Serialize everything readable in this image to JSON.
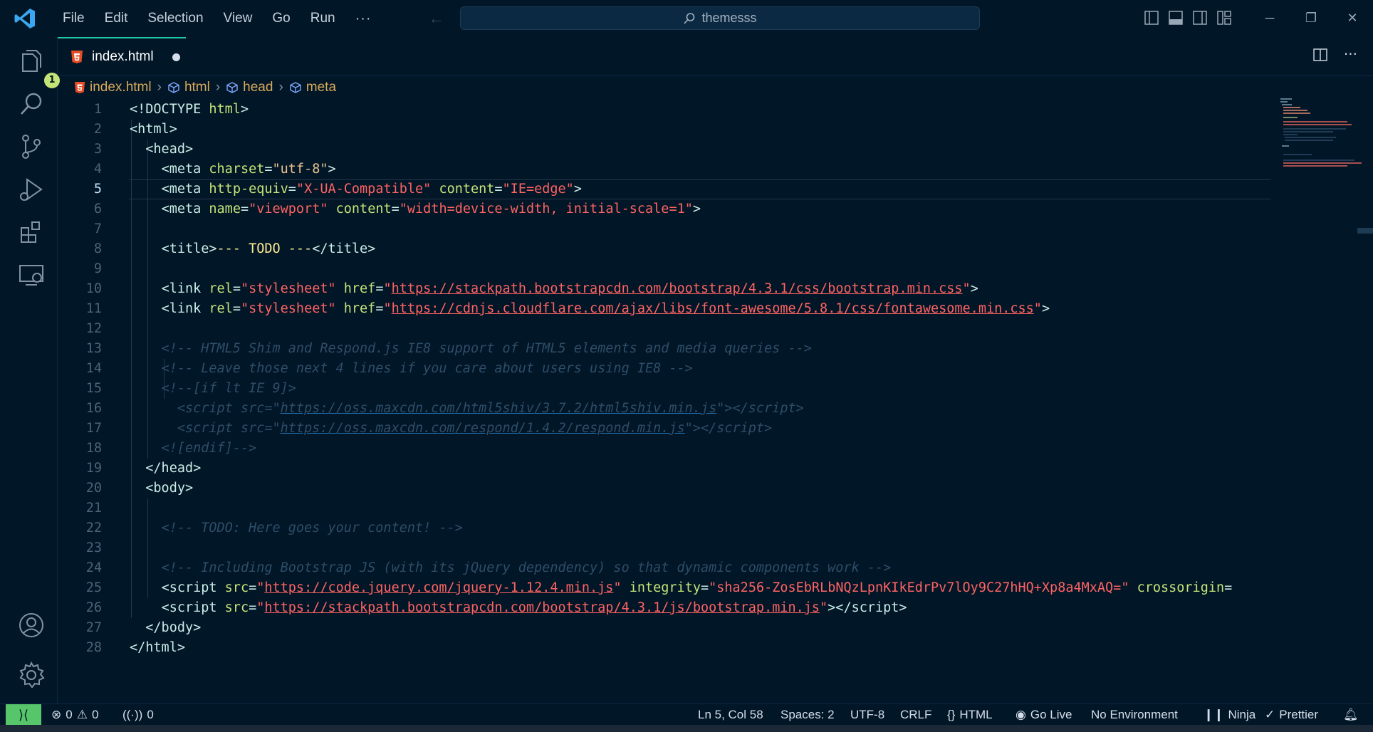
{
  "titlebar": {
    "menu": [
      "File",
      "Edit",
      "Selection",
      "View",
      "Go",
      "Run"
    ],
    "more": "···",
    "search_text": "themesss",
    "icons": [
      "toggle-primary-sidebar-icon",
      "toggle-panel-icon",
      "toggle-secondary-sidebar-icon",
      "customize-layout-icon"
    ],
    "window_controls": [
      "─",
      "❐",
      "✕"
    ]
  },
  "activitybar": {
    "items": [
      "explorer-icon",
      "search-icon",
      "source-control-icon",
      "run-debug-icon",
      "extensions-icon",
      "remote-explorer-icon"
    ],
    "explorer_badge": "1",
    "bottom": [
      "accounts-icon",
      "manage-gear-icon"
    ]
  },
  "tab": {
    "filename": "index.html",
    "modified": true
  },
  "breadcrumb": {
    "file": "index.html",
    "items": [
      "html",
      "head",
      "meta"
    ]
  },
  "editor": {
    "active_line": 5,
    "lines": [
      {
        "n": "1"
      },
      {
        "n": "2"
      },
      {
        "n": "3"
      },
      {
        "n": "4"
      },
      {
        "n": "5"
      },
      {
        "n": "6"
      },
      {
        "n": "7"
      },
      {
        "n": "8"
      },
      {
        "n": "9"
      },
      {
        "n": "10"
      },
      {
        "n": "11"
      },
      {
        "n": "12"
      },
      {
        "n": "13"
      },
      {
        "n": "14"
      },
      {
        "n": "15"
      },
      {
        "n": "16"
      },
      {
        "n": "17"
      },
      {
        "n": "18"
      },
      {
        "n": "19"
      },
      {
        "n": "20"
      },
      {
        "n": "21"
      },
      {
        "n": "22"
      },
      {
        "n": "23"
      },
      {
        "n": "24"
      },
      {
        "n": "25"
      },
      {
        "n": "26"
      },
      {
        "n": "27"
      },
      {
        "n": "28"
      }
    ],
    "code": {
      "l1": "<!DOCTYPE html>",
      "l8_title": "--- TODO ---",
      "l10_url": "https://stackpath.bootstrapcdn.com/bootstrap/4.3.1/css/bootstrap.min.css",
      "l11_url": "https://cdnjs.cloudflare.com/ajax/libs/font-awesome/5.8.1/css/fontawesome.min.css",
      "l13": "<!-- HTML5 Shim and Respond.js IE8 support of HTML5 elements and media queries -->",
      "l14": "<!-- Leave those next 4 lines if you care about users using IE8 -->",
      "l15": "<!--[if lt IE 9]>",
      "l16_url": "https://oss.maxcdn.com/html5shiv/3.7.2/html5shiv.min.js",
      "l17_url": "https://oss.maxcdn.com/respond/1.4.2/respond.min.js",
      "l18": "<![endif]-->",
      "l22": "<!-- TODO: Here goes your content! -->",
      "l24": "<!-- Including Bootstrap JS (with its jQuery dependency) so that dynamic components work -->",
      "l25_url": "https://code.jquery.com/jquery-1.12.4.min.js",
      "l25_integrity": "sha256-ZosEbRLbNQzLpnKIkEdrPv7lOy9C27hHQ+Xp8a4MxAQ=",
      "l26_url": "https://stackpath.bootstrapcdn.com/bootstrap/4.3.1/js/bootstrap.min.js"
    }
  },
  "statusbar": {
    "errors": "0",
    "warnings": "0",
    "ports": "0",
    "position": "Ln 5, Col 58",
    "spaces": "Spaces: 2",
    "encoding": "UTF-8",
    "eol": "CRLF",
    "language": "HTML",
    "golive": "Go Live",
    "environment": "No Environment",
    "ninja": "Ninja",
    "prettier": "Prettier"
  },
  "colors": {
    "background": "#011627",
    "accent": "#21c7a8",
    "remote": "#57c56a",
    "string_url": "#ff6363",
    "comment": "#2f4d67"
  }
}
